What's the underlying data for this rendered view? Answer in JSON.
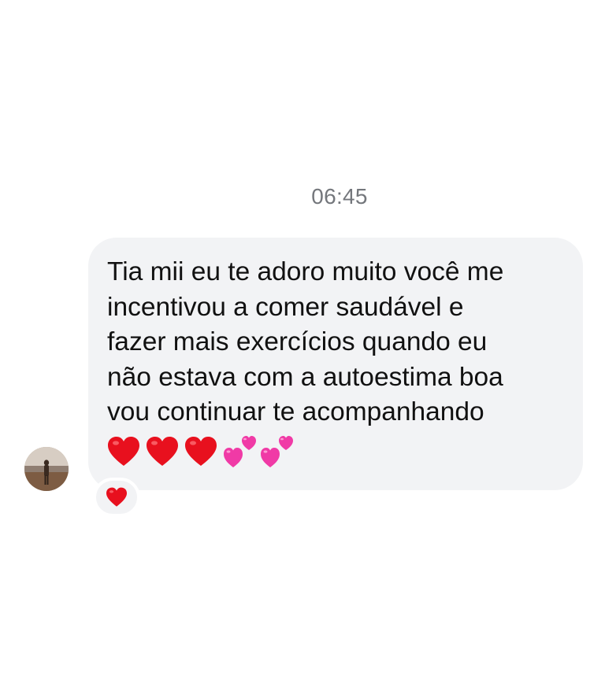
{
  "chat": {
    "timestamp": "06:45",
    "message": {
      "lines": [
        "Tia mii eu te adoro muito você me",
        "incentivou a comer saudável e",
        "fazer mais exercícios quando eu",
        "não estava com a autoestima boa",
        "vou continuar te acompanhando"
      ],
      "emojis": [
        "red-heart-icon",
        "red-heart-icon",
        "red-heart-icon",
        "two-hearts-icon",
        "two-hearts-icon"
      ]
    },
    "reaction": "red-heart-icon",
    "colors": {
      "bubble": "#f2f3f5",
      "heart_red": "#e8101e",
      "heart_pink": "#f03aa6",
      "timestamp": "#74777c"
    }
  }
}
